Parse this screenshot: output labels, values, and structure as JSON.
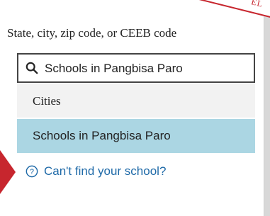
{
  "corner_tab": {
    "text": "EL"
  },
  "search": {
    "label": "State, city, zip code, or CEEB code",
    "value": "Schools in Pangbisa Paro",
    "icon": "search-icon"
  },
  "dropdown": {
    "group_header": "Cities",
    "options": [
      {
        "label": "Schools in Pangbisa Paro",
        "highlighted": true
      }
    ],
    "help_link": {
      "label": "Can't find your school?",
      "icon": "question-circle-icon"
    }
  },
  "colors": {
    "accent_red": "#c7262e",
    "highlight": "#abd6e3",
    "link": "#1f6aa8"
  }
}
